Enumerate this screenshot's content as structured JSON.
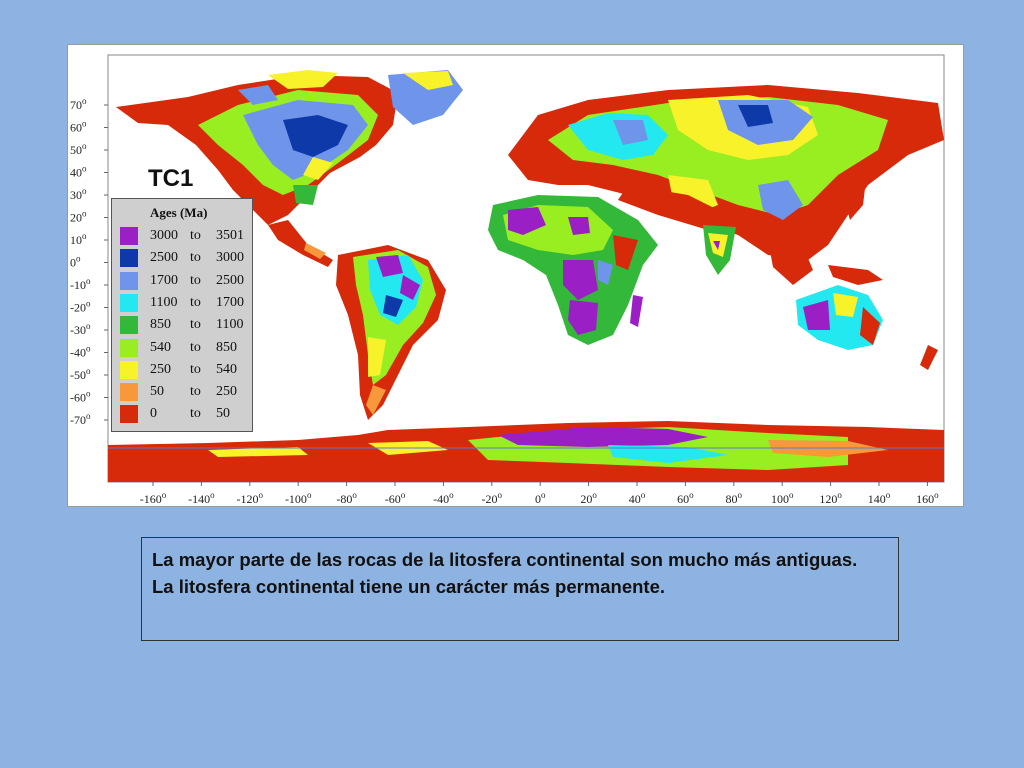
{
  "map": {
    "title": "TC1",
    "latitude_labels": [
      "70o",
      "60o",
      "50o",
      "40o",
      "30o",
      "20o",
      "10o",
      "0o",
      "-10o",
      "-20o",
      "-30o",
      "-40o",
      "-50o",
      "-60o",
      "-70o"
    ],
    "longitude_labels": [
      "-160o",
      "-140o",
      "-120o",
      "-100o",
      "-80o",
      "-60o",
      "-40o",
      "-20o",
      "0o",
      "20o",
      "40o",
      "60o",
      "80o",
      "100o",
      "120o",
      "140o",
      "160o"
    ]
  },
  "legend": {
    "title": "Ages (Ma)",
    "items": [
      {
        "from": "3000",
        "sep": "to",
        "to": "3501",
        "color": "#9a1fc4"
      },
      {
        "from": "2500",
        "sep": "to",
        "to": "3000",
        "color": "#0d3aa8"
      },
      {
        "from": "1700",
        "sep": "to",
        "to": "2500",
        "color": "#6e95ea"
      },
      {
        "from": "1100",
        "sep": "to",
        "to": "1700",
        "color": "#24e8f0"
      },
      {
        "from": "850",
        "sep": "to",
        "to": "1100",
        "color": "#33b83a"
      },
      {
        "from": "540",
        "sep": "to",
        "to": "850",
        "color": "#99ee22"
      },
      {
        "from": "250",
        "sep": "to",
        "to": "540",
        "color": "#f7f22a"
      },
      {
        "from": "50",
        "sep": "to",
        "to": "250",
        "color": "#f7983a"
      },
      {
        "from": "0",
        "sep": "to",
        "to": "50",
        "color": "#d62a0a"
      }
    ]
  },
  "caption": {
    "line1": "La mayor parte de las rocas de la litosfera continental son mucho más antiguas.",
    "line2": "La litosfera continental tiene un carácter más permanente."
  },
  "colors": {
    "background": "#8db3e2",
    "map_background": "#ffffff",
    "legend_background": "#cfcfcf"
  }
}
